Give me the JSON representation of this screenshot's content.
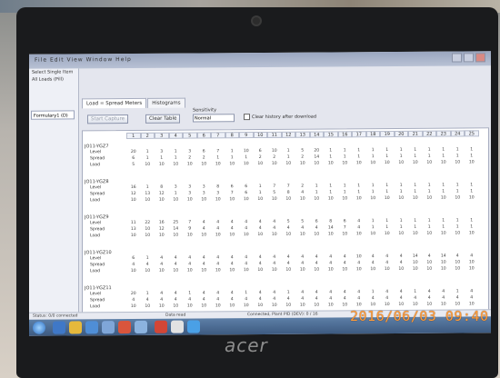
{
  "photo": {
    "timestamp": "2016/06/03 09:40",
    "brand": "acer"
  },
  "app": {
    "menu": "File  Edit  View  Window  Help",
    "left_items": [
      "Select Single Item",
      "All Loads (Pill)"
    ],
    "left_tab": "Formulary1 (D)",
    "tabs": [
      "Load = Spread Meters",
      "Histograms"
    ],
    "toolbar": {
      "start_label": "Start Capture",
      "clear_label": "Clear Table",
      "sensitivity_label": "Sensitivity",
      "sensitivity_value": "Normal",
      "checkbox_label": "Clear history after download"
    },
    "columns": [
      "1",
      "2",
      "3",
      "4",
      "5",
      "6",
      "7",
      "8",
      "9",
      "10",
      "11",
      "12",
      "13",
      "14",
      "15",
      "16",
      "17",
      "18",
      "19",
      "20",
      "21",
      "22",
      "23",
      "24",
      "25"
    ],
    "groups": [
      {
        "title": "JO11-YGZ7",
        "rows": [
          {
            "label": "Level",
            "values": [
              "20",
              "1",
              "3",
              "1",
              "3",
              "6",
              "7",
              "1",
              "10",
              "6",
              "10",
              "1",
              "5",
              "20",
              "1",
              "1",
              "1",
              "1",
              "1",
              "1",
              "1",
              "1",
              "1",
              "1",
              "1"
            ]
          },
          {
            "label": "Spread",
            "values": [
              "6",
              "1",
              "1",
              "1",
              "2",
              "2",
              "1",
              "1",
              "1",
              "2",
              "2",
              "1",
              "2",
              "14",
              "1",
              "1",
              "1",
              "1",
              "1",
              "1",
              "1",
              "1",
              "1",
              "1",
              "1"
            ]
          },
          {
            "label": "Load",
            "values": [
              "5",
              "10",
              "10",
              "10",
              "10",
              "10",
              "10",
              "10",
              "10",
              "10",
              "10",
              "10",
              "10",
              "10",
              "10",
              "10",
              "10",
              "10",
              "10",
              "10",
              "10",
              "10",
              "10",
              "10",
              "10"
            ]
          }
        ]
      },
      {
        "title": "JO11-YGZ8",
        "rows": [
          {
            "label": "Level",
            "values": [
              "16",
              "1",
              "8",
              "3",
              "3",
              "3",
              "8",
              "6",
              "6",
              "1",
              "7",
              "7",
              "2",
              "1",
              "1",
              "1",
              "1",
              "1",
              "1",
              "1",
              "1",
              "1",
              "1",
              "1",
              "1"
            ]
          },
          {
            "label": "Spread",
            "values": [
              "12",
              "13",
              "12",
              "1",
              "3",
              "3",
              "3",
              "7",
              "6",
              "1",
              "5",
              "8",
              "4",
              "1",
              "1",
              "1",
              "1",
              "1",
              "1",
              "1",
              "1",
              "1",
              "1",
              "1",
              "1"
            ]
          },
          {
            "label": "Load",
            "values": [
              "10",
              "10",
              "10",
              "10",
              "10",
              "10",
              "10",
              "10",
              "10",
              "10",
              "10",
              "10",
              "10",
              "10",
              "10",
              "10",
              "10",
              "10",
              "10",
              "10",
              "10",
              "10",
              "10",
              "10",
              "10"
            ]
          }
        ]
      },
      {
        "title": "JO11-YGZ9",
        "rows": [
          {
            "label": "Level",
            "values": [
              "11",
              "22",
              "16",
              "25",
              "7",
              "4",
              "4",
              "4",
              "4",
              "4",
              "4",
              "5",
              "5",
              "6",
              "8",
              "6",
              "4",
              "1",
              "1",
              "1",
              "1",
              "1",
              "1",
              "1",
              "1"
            ]
          },
          {
            "label": "Spread",
            "values": [
              "13",
              "10",
              "12",
              "14",
              "9",
              "4",
              "4",
              "4",
              "4",
              "4",
              "4",
              "4",
              "4",
              "4",
              "14",
              "7",
              "4",
              "1",
              "1",
              "1",
              "1",
              "1",
              "1",
              "1",
              "1"
            ]
          },
          {
            "label": "Load",
            "values": [
              "10",
              "10",
              "10",
              "10",
              "10",
              "10",
              "10",
              "10",
              "10",
              "10",
              "10",
              "10",
              "10",
              "10",
              "10",
              "10",
              "10",
              "10",
              "10",
              "10",
              "10",
              "10",
              "10",
              "10",
              "10"
            ]
          }
        ]
      },
      {
        "title": "JO11-YGZ10",
        "rows": [
          {
            "label": "Level",
            "values": [
              "6",
              "1",
              "4",
              "4",
              "4",
              "4",
              "4",
              "4",
              "4",
              "4",
              "4",
              "4",
              "4",
              "4",
              "4",
              "4",
              "10",
              "4",
              "4",
              "4",
              "14",
              "4",
              "14",
              "4",
              "4"
            ]
          },
          {
            "label": "Spread",
            "values": [
              "4",
              "4",
              "4",
              "4",
              "4",
              "4",
              "4",
              "4",
              "4",
              "4",
              "4",
              "4",
              "4",
              "4",
              "4",
              "4",
              "4",
              "4",
              "4",
              "4",
              "10",
              "10",
              "10",
              "10",
              "10"
            ]
          },
          {
            "label": "Load",
            "values": [
              "10",
              "10",
              "10",
              "10",
              "10",
              "10",
              "10",
              "10",
              "10",
              "10",
              "10",
              "10",
              "10",
              "10",
              "10",
              "10",
              "10",
              "10",
              "10",
              "10",
              "10",
              "10",
              "10",
              "10",
              "10"
            ]
          }
        ]
      },
      {
        "title": "JO11-YGZ11",
        "rows": [
          {
            "label": "Level",
            "values": [
              "20",
              "1",
              "4",
              "4",
              "1",
              "4",
              "4",
              "4",
              "1",
              "4",
              "4",
              "1",
              "4",
              "4",
              "4",
              "4",
              "4",
              "1",
              "4",
              "4",
              "1",
              "4",
              "4",
              "1",
              "4"
            ]
          },
          {
            "label": "Spread",
            "values": [
              "4",
              "4",
              "4",
              "4",
              "4",
              "4",
              "4",
              "4",
              "4",
              "4",
              "4",
              "4",
              "4",
              "4",
              "4",
              "4",
              "4",
              "4",
              "4",
              "4",
              "4",
              "4",
              "4",
              "4",
              "4"
            ]
          },
          {
            "label": "Load",
            "values": [
              "10",
              "10",
              "10",
              "10",
              "10",
              "10",
              "10",
              "10",
              "10",
              "10",
              "10",
              "10",
              "10",
              "10",
              "10",
              "10",
              "10",
              "10",
              "10",
              "10",
              "10",
              "10",
              "10",
              "10",
              "10"
            ]
          }
        ]
      }
    ],
    "status": {
      "left": "Status: 0/0 connected",
      "center": "Data read",
      "right": "Connected, Plant PID (DEV): 0 / 16"
    }
  }
}
